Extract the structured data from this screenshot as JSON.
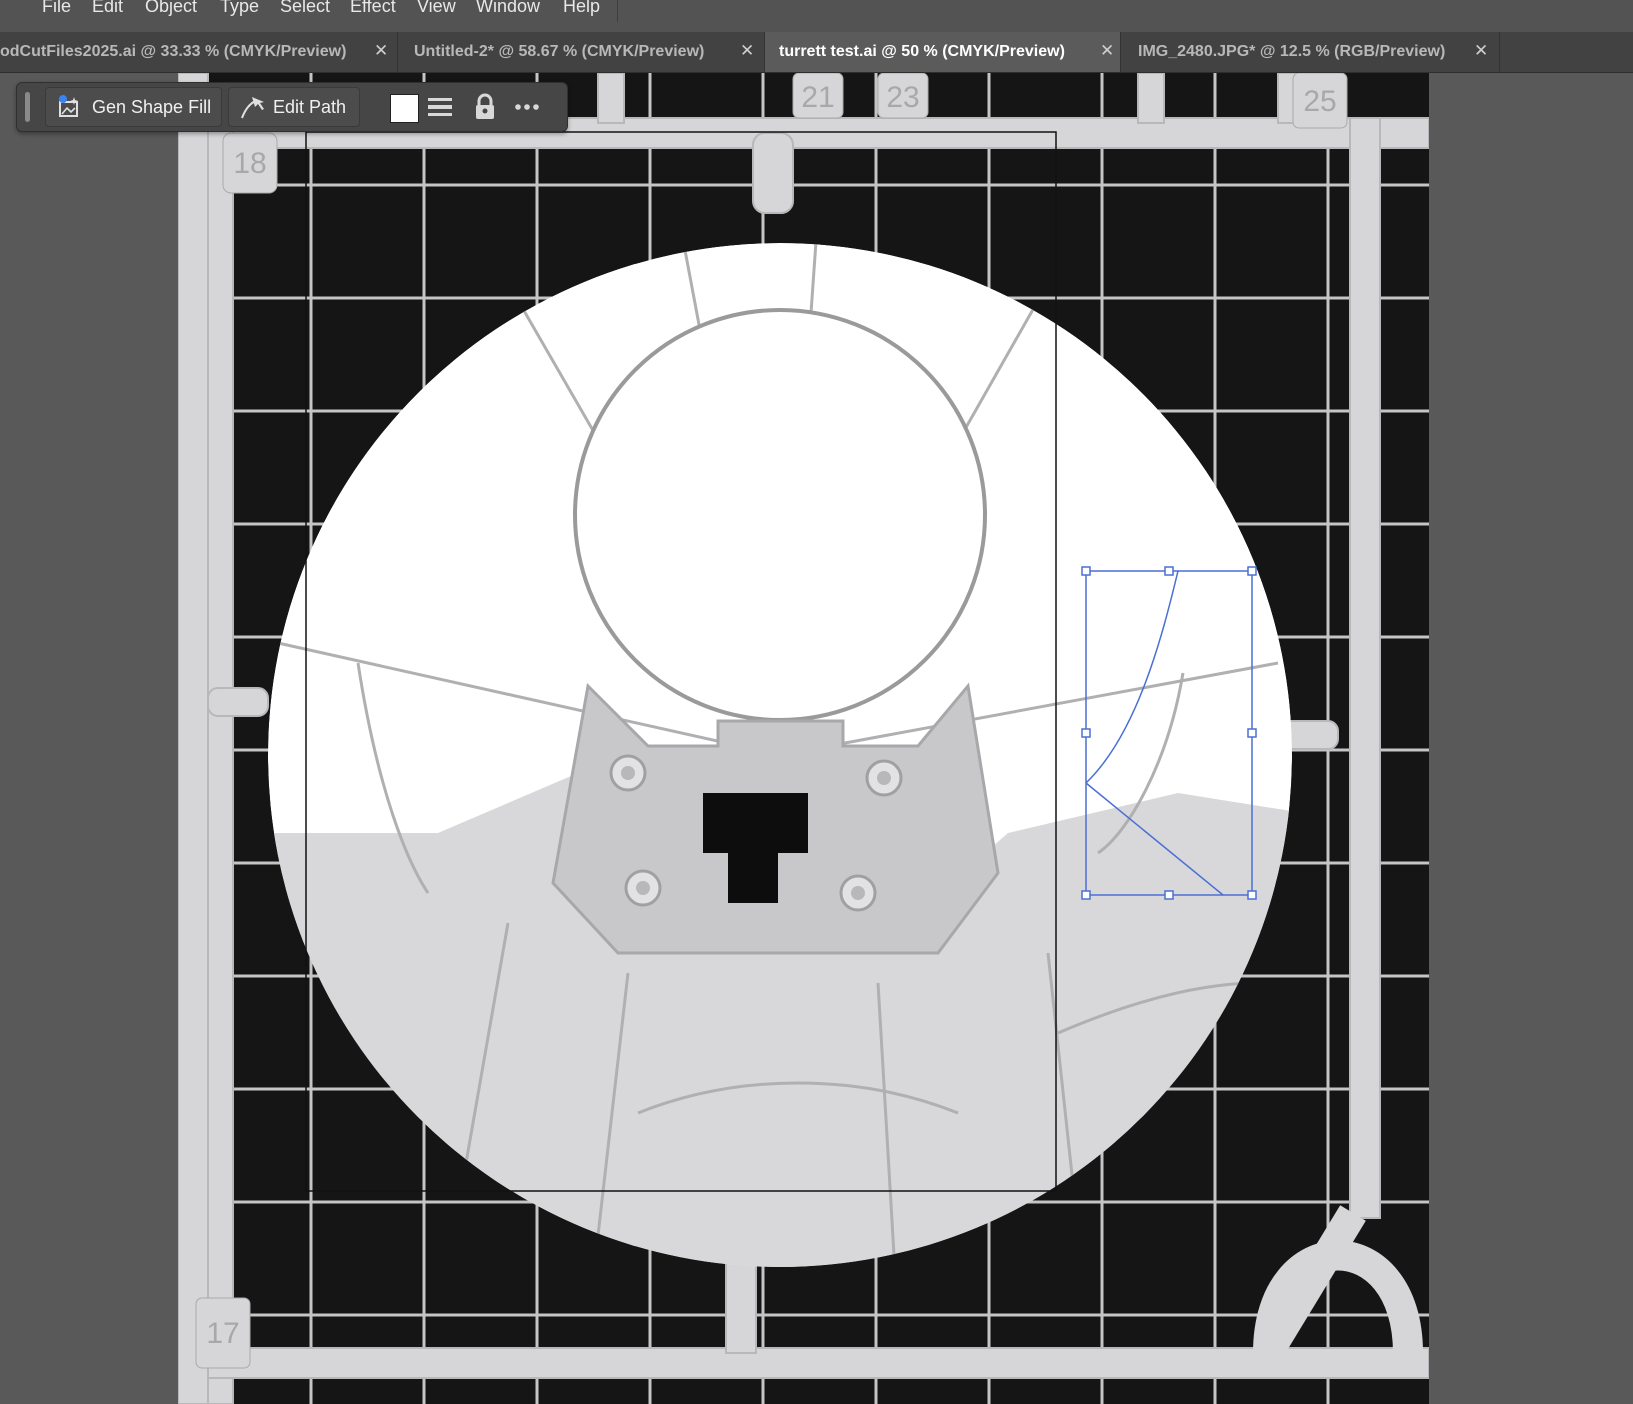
{
  "menu": [
    "File",
    "Edit",
    "Object",
    "Type",
    "Select",
    "Effect",
    "View",
    "Window",
    "Help"
  ],
  "tabs": [
    {
      "label": "odCutFiles2025.ai @ 33.33 % (CMYK/Preview)",
      "active": false
    },
    {
      "label": "Untitled-2* @ 58.67 % (CMYK/Preview)",
      "active": false
    },
    {
      "label": "turrett test.ai @ 50 % (CMYK/Preview)",
      "active": true
    },
    {
      "label": "IMG_2480.JPG* @ 12.5 % (RGB/Preview)",
      "active": false
    }
  ],
  "tab_close_glyph": "✕",
  "taskbar": {
    "gen_shape_fill_label": "Gen Shape Fill",
    "edit_path_label": "Edit Path",
    "fill_color": "#ffffff"
  },
  "sprue_numbers": [
    "18",
    "21",
    "23",
    "25",
    "17"
  ],
  "colors": {
    "selection": "#4a6fd4",
    "plastic": "#d6d6d8",
    "mat": "#151515",
    "grid_line": "#e4e4e4"
  }
}
